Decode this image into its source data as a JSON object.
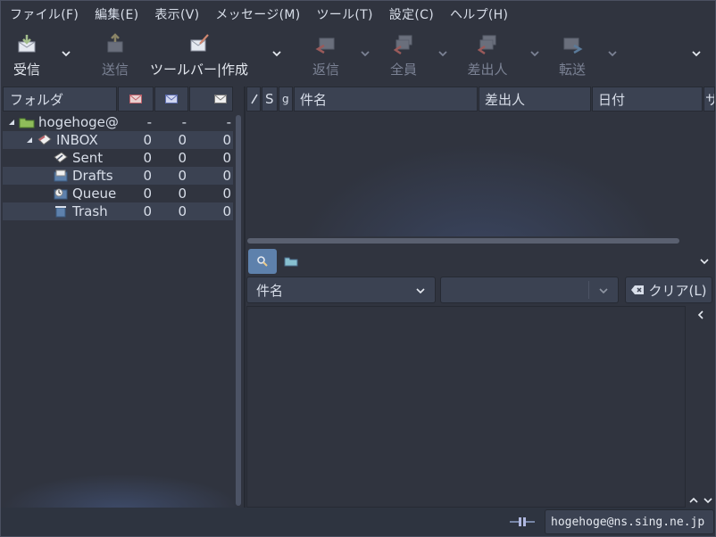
{
  "menu": [
    "ファイル(F)",
    "編集(E)",
    "表示(V)",
    "メッセージ(M)",
    "ツール(T)",
    "設定(C)",
    "ヘルプ(H)"
  ],
  "toolbar": {
    "receive": "受信",
    "send": "送信",
    "compose": "ツールバー|作成",
    "reply": "返信",
    "reply_all": "全員",
    "sender": "差出人",
    "forward": "転送"
  },
  "folders": {
    "header": "フォルダ",
    "rows": [
      {
        "name": "hogehoge@",
        "unread": "-",
        "new": "-",
        "total": "-"
      },
      {
        "name": "INBOX",
        "unread": "0",
        "new": "0",
        "total": "0"
      },
      {
        "name": "Sent",
        "unread": "0",
        "new": "0",
        "total": "0"
      },
      {
        "name": "Drafts",
        "unread": "0",
        "new": "0",
        "total": "0"
      },
      {
        "name": "Queue",
        "unread": "0",
        "new": "0",
        "total": "0"
      },
      {
        "name": "Trash",
        "unread": "0",
        "new": "0",
        "total": "0"
      }
    ]
  },
  "columns": {
    "s": "S",
    "clip": "g",
    "subject": "件名",
    "from": "差出人",
    "date": "日付",
    "size": "サ"
  },
  "filter": {
    "field": "件名",
    "value": "",
    "clear": "クリア(L)"
  },
  "status": {
    "account": "hogehoge@ns.sing.ne.jp"
  },
  "colors": {
    "bg": "#30343f",
    "accent": "#5e81ac"
  }
}
